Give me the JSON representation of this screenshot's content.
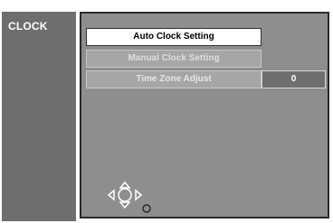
{
  "section": {
    "title": "CLOCK"
  },
  "menu": {
    "items": [
      {
        "label": "Auto Clock Setting",
        "state": "selected"
      },
      {
        "label": "Manual Clock Setting",
        "state": "disabled"
      },
      {
        "label": "Time Zone Adjust",
        "state": "normal",
        "value": "0"
      }
    ]
  },
  "icons": {
    "navigation": "directional-pad-icon",
    "return": "return-dot-icon"
  },
  "colors": {
    "panel_dark": "#6e6e6e",
    "panel_main": "#8e8e8e",
    "selected_bg": "#ffffff",
    "value_bg": "#6f6f6f"
  }
}
